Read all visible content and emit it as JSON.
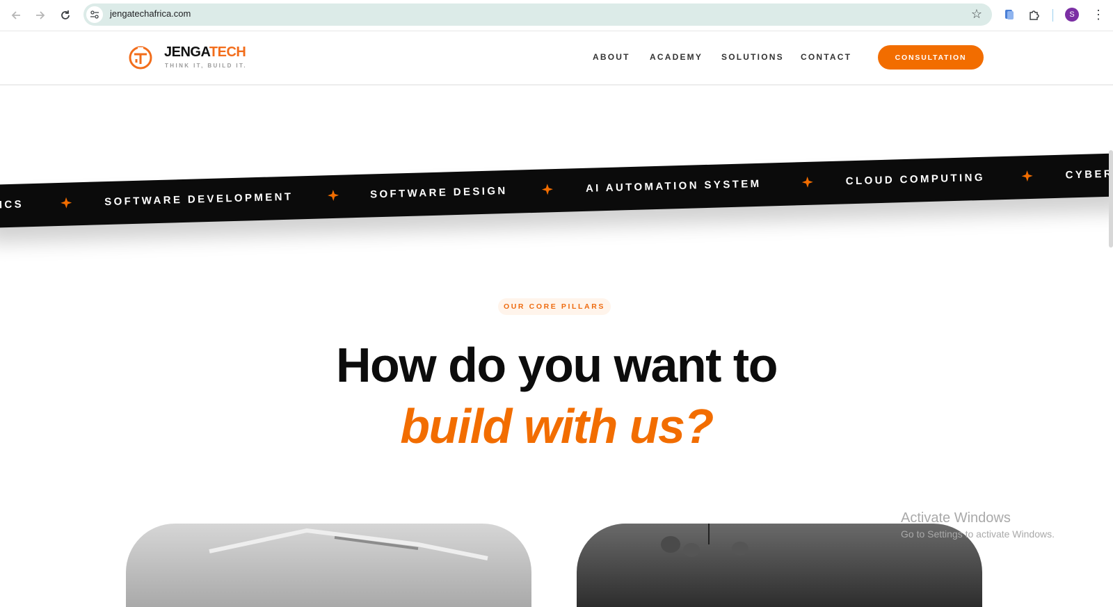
{
  "browser": {
    "url": "jengatechafrica.com",
    "profile_initial": "S",
    "icons": [
      "back-arrow-icon",
      "forward-arrow-icon",
      "reload-icon",
      "site-info-icon",
      "bookmark-star-icon",
      "extension-icon",
      "puzzle-icon",
      "more-vert-icon"
    ]
  },
  "header": {
    "logo_part1": "JENGA",
    "logo_part2": "TECH",
    "tagline": "THINK IT, BUILD IT.",
    "nav": [
      "ABOUT",
      "ACADEMY",
      "SOLUTIONS",
      "CONTACT"
    ],
    "cta": "CONSULTATION"
  },
  "ticker": {
    "items": [
      "TICS",
      "SOFTWARE DEVELOPMENT",
      "SOFTWARE DESIGN",
      "AI AUTOMATION SYSTEM",
      "CLOUD COMPUTING",
      "CYBER"
    ]
  },
  "section": {
    "badge": "OUR CORE PILLARS",
    "headline_line1": "How do you want to",
    "headline_line2": "build with us?"
  },
  "watermark": {
    "title": "Activate Windows",
    "subtitle": "Go to Settings to activate Windows."
  },
  "colors": {
    "brand_orange": "#f26d00",
    "ticker_bg": "#0b0b0b",
    "headline": "#0c0c0c",
    "omnibox": "#dcebe8"
  }
}
